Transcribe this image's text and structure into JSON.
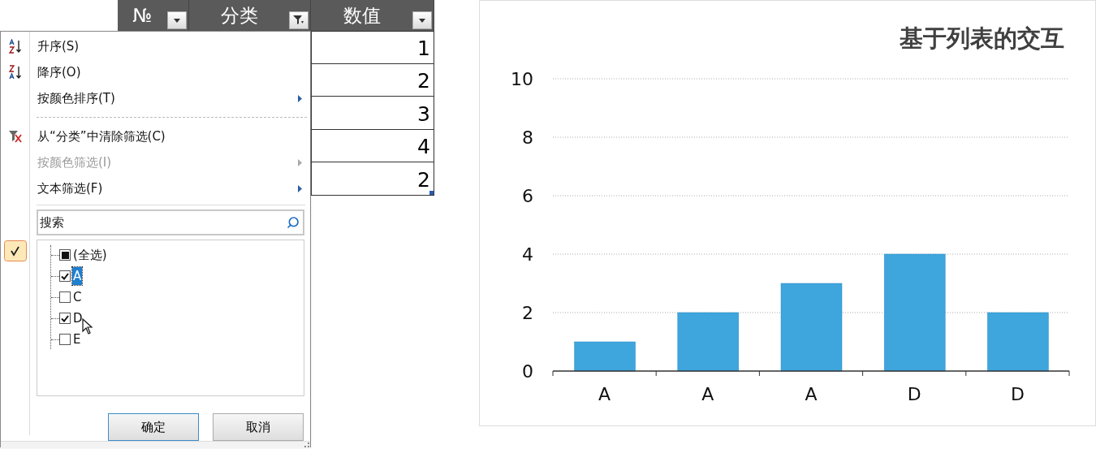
{
  "table": {
    "columns": [
      {
        "label": "№",
        "filtered": false
      },
      {
        "label": "分类",
        "filtered": true
      },
      {
        "label": "数值",
        "filtered": false
      }
    ],
    "values": [
      "1",
      "2",
      "3",
      "4",
      "2"
    ]
  },
  "filter_menu": {
    "items": [
      {
        "kind": "sort_asc",
        "label": "升序(S)",
        "disabled": false,
        "submenu": false
      },
      {
        "kind": "sort_desc",
        "label": "降序(O)",
        "disabled": false,
        "submenu": false
      },
      {
        "kind": "plain",
        "label": "按颜色排序(T)",
        "disabled": false,
        "submenu": true
      },
      {
        "kind": "separator"
      },
      {
        "kind": "clear_filter",
        "label": "从“分类”中清除筛选(C)",
        "disabled": false,
        "submenu": false
      },
      {
        "kind": "plain",
        "label": "按颜色筛选(I)",
        "disabled": true,
        "submenu": true
      },
      {
        "kind": "plain",
        "label": "文本筛选(F)",
        "disabled": false,
        "submenu": true
      }
    ],
    "search": {
      "placeholder": "搜索"
    },
    "options": [
      {
        "label": "(全选)",
        "checked": false,
        "indeterminate": true,
        "selected": false
      },
      {
        "label": "A",
        "checked": true,
        "indeterminate": false,
        "selected": true
      },
      {
        "label": "C",
        "checked": false,
        "indeterminate": false,
        "selected": false
      },
      {
        "label": "D",
        "checked": true,
        "indeterminate": false,
        "selected": false
      },
      {
        "label": "E",
        "checked": false,
        "indeterminate": false,
        "selected": false
      }
    ],
    "buttons": [
      "确定",
      "取消"
    ]
  },
  "chart": {
    "chart_data": {
      "type": "bar",
      "title": "基于列表的交互",
      "categories": [
        "A",
        "A",
        "A",
        "D",
        "D"
      ],
      "values": [
        1,
        2,
        3,
        4,
        2
      ],
      "color": "#3ea5dd",
      "ylim": [
        0,
        10
      ],
      "yticks": [
        0,
        2,
        4,
        6,
        8,
        10
      ],
      "grid": true
    }
  }
}
